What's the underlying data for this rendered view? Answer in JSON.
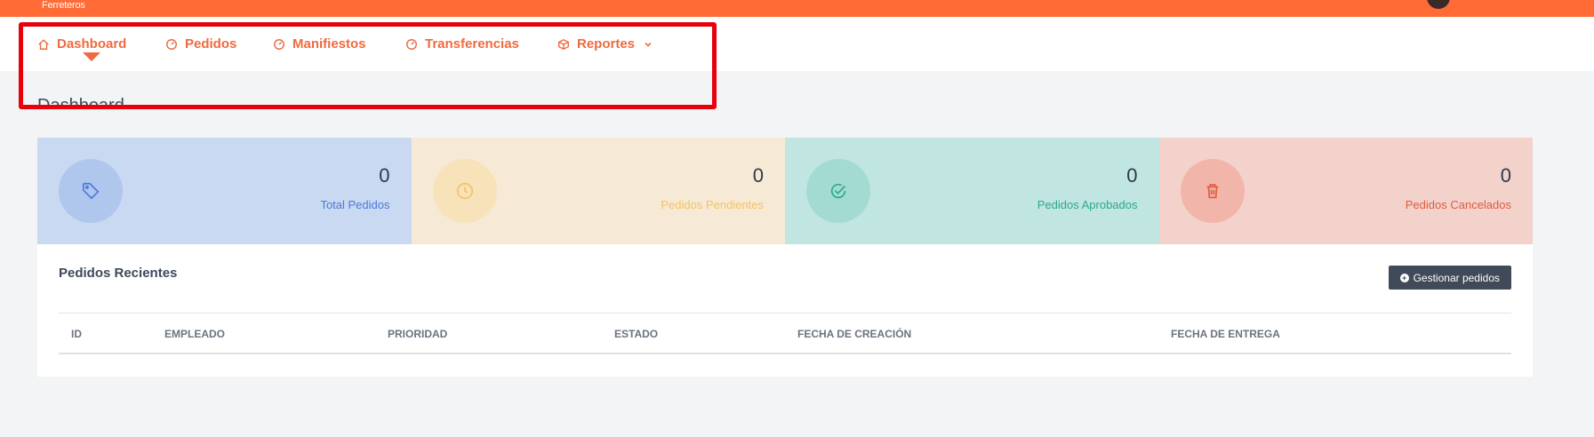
{
  "topbar": {
    "brand": "Ferreteros"
  },
  "nav": {
    "items": [
      {
        "label": "Dashboard",
        "icon": "home-icon"
      },
      {
        "label": "Pedidos",
        "icon": "gauge-icon"
      },
      {
        "label": "Manifiestos",
        "icon": "gauge-icon"
      },
      {
        "label": "Transferencias",
        "icon": "gauge-icon"
      },
      {
        "label": "Reportes",
        "icon": "box-icon"
      }
    ]
  },
  "page_title": "Dashboard",
  "stats": [
    {
      "value": "0",
      "label": "Total Pedidos",
      "icon": "tag-icon",
      "bg": "#cad9f2",
      "circle": "#afc6ed",
      "accent": "#4a7bd8"
    },
    {
      "value": "0",
      "label": "Pedidos Pendientes",
      "icon": "clock-icon",
      "bg": "#f6ead6",
      "circle": "#f7e2b9",
      "accent": "#f6c261"
    },
    {
      "value": "0",
      "label": "Pedidos Aprobados",
      "icon": "check-circle-icon",
      "bg": "#c1e5e1",
      "circle": "#a3dbd3",
      "accent": "#2aa98f"
    },
    {
      "value": "0",
      "label": "Pedidos Cancelados",
      "icon": "trash-icon",
      "bg": "#f3d2cb",
      "circle": "#f1b6a9",
      "accent": "#e35a3f"
    }
  ],
  "recent": {
    "title": "Pedidos Recientes",
    "button": "Gestionar pedidos",
    "columns": [
      "ID",
      "EMPLEADO",
      "PRIORIDAD",
      "ESTADO",
      "FECHA DE CREACIÓN",
      "FECHA DE ENTREGA"
    ]
  },
  "colors": {
    "brand": "#ff6a35",
    "nav_text": "#ef6a3f",
    "highlight": "#e8000b",
    "button": "#414a59"
  }
}
